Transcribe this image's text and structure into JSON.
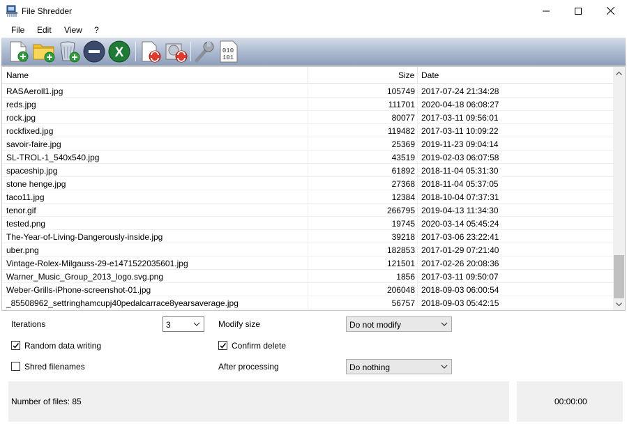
{
  "window": {
    "title": "File Shredder"
  },
  "menu": {
    "items": [
      "File",
      "Edit",
      "View",
      "?"
    ]
  },
  "toolbar": {
    "buttons": [
      "add-file",
      "add-folder",
      "add-recycle-bin",
      "remove",
      "clear",
      "shred-files",
      "shred-disk",
      "settings",
      "binary"
    ]
  },
  "list": {
    "headers": {
      "name": "Name",
      "size": "Size",
      "date": "Date"
    },
    "rows": [
      {
        "name": "RASAeroll1.jpg",
        "size": "105749",
        "date": "2017-07-24 21:34:28"
      },
      {
        "name": "reds.jpg",
        "size": "111701",
        "date": "2020-04-18 06:08:27"
      },
      {
        "name": "rock.jpg",
        "size": "80077",
        "date": "2017-03-11 09:56:01"
      },
      {
        "name": "rockfixed.jpg",
        "size": "119482",
        "date": "2017-03-11 10:09:22"
      },
      {
        "name": "savoir-faire.jpg",
        "size": "25369",
        "date": "2019-11-23 09:04:14"
      },
      {
        "name": "SL-TROL-1_540x540.jpg",
        "size": "43519",
        "date": "2019-02-03 06:07:58"
      },
      {
        "name": "spaceship.jpg",
        "size": "61892",
        "date": "2018-11-04 05:31:30"
      },
      {
        "name": "stone henge.jpg",
        "size": "27368",
        "date": "2018-11-04 05:37:05"
      },
      {
        "name": "taco11.jpg",
        "size": "12384",
        "date": "2018-10-04 07:37:31"
      },
      {
        "name": "tenor.gif",
        "size": "266795",
        "date": "2019-04-13 11:34:30"
      },
      {
        "name": "tested.png",
        "size": "19745",
        "date": "2020-03-14 05:45:24"
      },
      {
        "name": "The-Year-of-Living-Dangerously-inside.jpg",
        "size": "39218",
        "date": "2017-03-06 23:22:41"
      },
      {
        "name": "uber.png",
        "size": "182853",
        "date": "2017-01-29 07:21:40"
      },
      {
        "name": "Vintage-Rolex-Milgauss-29-e1471522035601.jpg",
        "size": "121501",
        "date": "2017-02-26 20:08:36"
      },
      {
        "name": "Warner_Music_Group_2013_logo.svg.png",
        "size": "1856",
        "date": "2017-03-11 09:50:07"
      },
      {
        "name": "Weber-Grills-iPhone-screenshot-01.jpg",
        "size": "206048",
        "date": "2018-09-03 06:00:54"
      },
      {
        "name": "_85508962_settringhamcupj40pedalcarrace8yearsaverage.jpg",
        "size": "56757",
        "date": "2018-09-03 05:42:15"
      }
    ]
  },
  "options": {
    "iterations_label": "Iterations",
    "iterations_value": "3",
    "modify_size_label": "Modify size",
    "modify_size_value": "Do not modify",
    "random_data_label": "Random data writing",
    "random_data_checked": true,
    "confirm_delete_label": "Confirm delete",
    "confirm_delete_checked": true,
    "shred_filenames_label": "Shred filenames",
    "shred_filenames_checked": false,
    "after_processing_label": "After processing",
    "after_processing_value": "Do nothing"
  },
  "status": {
    "files_count": "Number of files: 85",
    "timer": "00:00:00"
  }
}
